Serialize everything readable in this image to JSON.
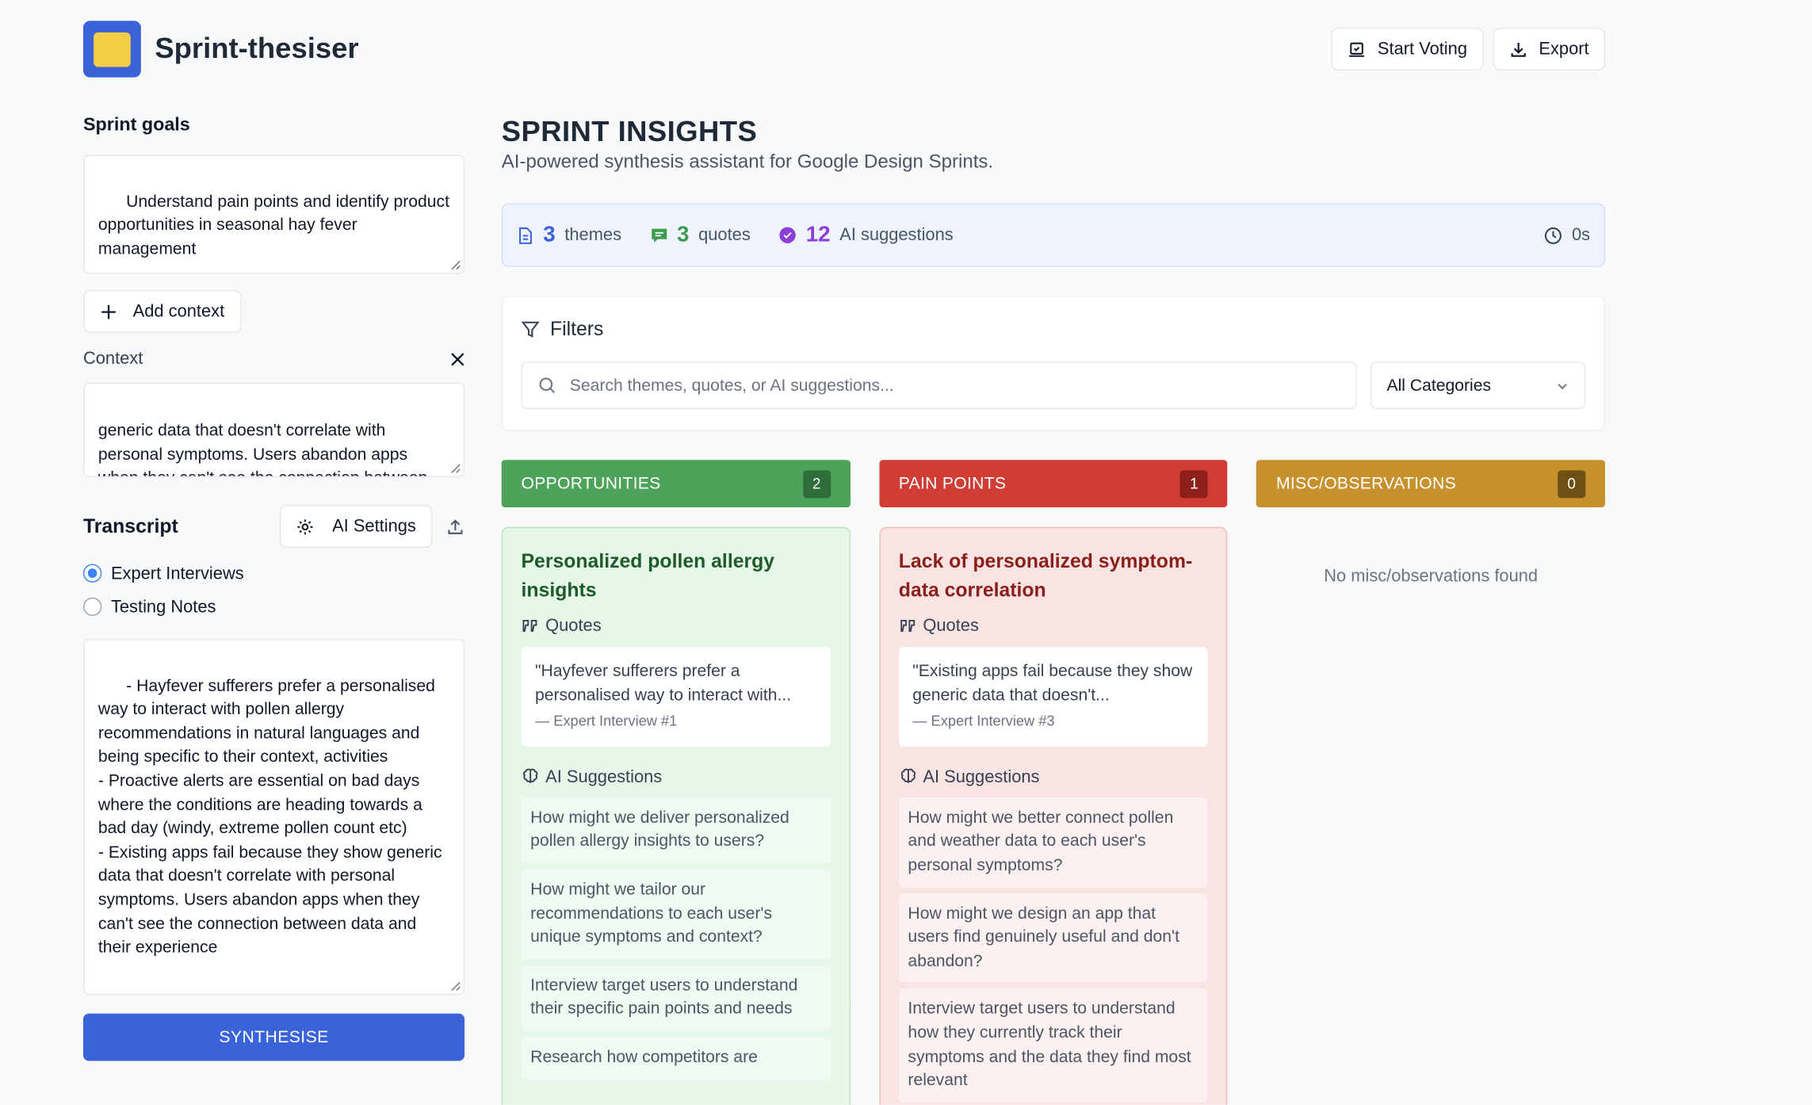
{
  "app": {
    "title": "Sprint-thesiser"
  },
  "header": {
    "start_voting": "Start Voting",
    "export": "Export"
  },
  "left": {
    "goals_label": "Sprint goals",
    "goals_value": "Understand pain points and identify product opportunities in seasonal hay fever management",
    "add_context": "Add context",
    "context_label": "Context",
    "context_value": "generic data that doesn't correlate with personal symptoms. Users abandon apps when they can't see the connection between data and their experience",
    "transcript_label": "Transcript",
    "ai_settings": "AI Settings",
    "radio_1": "Expert Interviews",
    "radio_2": "Testing Notes",
    "transcript_value": "- Hayfever sufferers prefer a personalised way to interact with pollen allergy recommendations in natural languages and being specific to their context, activities\n- Proactive alerts are essential on bad days where the conditions are heading towards a bad day (windy, extreme pollen count etc)\n- Existing apps fail because they show generic data that doesn't correlate with personal symptoms. Users abandon apps when they can't see the connection between data and their experience",
    "synthesise": "SYNTHESISE"
  },
  "main": {
    "title": "SPRINT INSIGHTS",
    "subtitle": "AI-powered synthesis assistant for Google Design Sprints.",
    "stats": {
      "themes_num": "3",
      "themes_label": "themes",
      "quotes_num": "3",
      "quotes_label": "quotes",
      "ai_num": "12",
      "ai_label": "AI suggestions",
      "timer": "0s"
    },
    "filters": {
      "title": "Filters",
      "search_placeholder": "Search themes, quotes, or AI suggestions...",
      "category": "All Categories"
    },
    "columns": [
      {
        "title": "OPPORTUNITIES",
        "count": "2",
        "color": "#4ea35a",
        "card_title": "Personalized pollen allergy insights",
        "quotes_label": "Quotes",
        "quote": "\"Hayfever sufferers prefer a personalised way to interact with...",
        "quote_src": "— Expert Interview #1",
        "ai_label": "AI Suggestions",
        "suggestions": [
          "How might we deliver personalized pollen allergy insights to users?",
          "How might we tailor our recommendations to each user's unique symptoms and context?",
          "Interview target users to understand their specific pain points and needs",
          "Research how competitors are"
        ]
      },
      {
        "title": "PAIN POINTS",
        "count": "1",
        "color": "#d03d35",
        "card_title": "Lack of personalized symptom-data correlation",
        "quotes_label": "Quotes",
        "quote": "\"Existing apps fail because they show generic data that doesn't...",
        "quote_src": "— Expert Interview #3",
        "ai_label": "AI Suggestions",
        "suggestions": [
          "How might we better connect pollen and weather data to each user's personal symptoms?",
          "How might we design an app that users find genuinely useful and don't abandon?",
          "Interview target users to understand how they currently track their symptoms and the data they find most relevant"
        ]
      },
      {
        "title": "MISC/OBSERVATIONS",
        "count": "0",
        "color": "#c7922e",
        "empty": "No misc/observations found"
      }
    ]
  }
}
